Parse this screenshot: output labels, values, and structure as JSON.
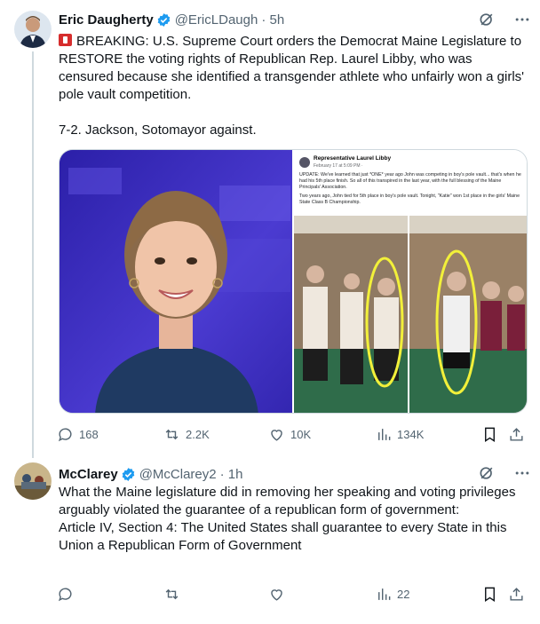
{
  "tweets": [
    {
      "name": "Eric Daugherty",
      "handle": "@EricLDaugh",
      "time": "· 5h",
      "text": "BREAKING: U.S. Supreme Court orders the Democrat Maine Legislature to RESTORE the voting rights of Republican Rep. Laurel Libby, who was censured because she identified a transgender athlete who unfairly won a girls' pole vault competition.\n\n7-2. Jackson, Sotomayor against.",
      "stats": {
        "replies": "168",
        "reposts": "2.2K",
        "likes": "10K",
        "views": "134K"
      },
      "embedded_post": {
        "author": "Representative Laurel Libby",
        "date": "February 17 at 5:09 PM ·",
        "body1": "UPDATE: We've learned that just *ONE* year ago John was competing in boy's pole vault... that's when he had his 5th place finish. So all of this transpired in the last year, with the full blessing of the Maine Principals' Association.",
        "body2": "Two years ago, John tied for 5th place in boy's pole vault. Tonight, \"Katie\" won 1st place in the girls' Maine State Class B Championship."
      }
    },
    {
      "name": "McClarey",
      "handle": "@McClarey2",
      "time": "· 1h",
      "text": "What the Maine legislature did in removing her speaking and voting privileges arguably violated the guarantee of a republican form of government:\nArticle IV, Section 4: The United States shall guarantee to every State in this Union a Republican Form of Government",
      "stats": {
        "replies": "",
        "reposts": "",
        "likes": "",
        "views": "22"
      }
    }
  ],
  "colors": {
    "verified": "#1d9bf0",
    "muted": "#536471",
    "alert": "#d62d2d"
  }
}
